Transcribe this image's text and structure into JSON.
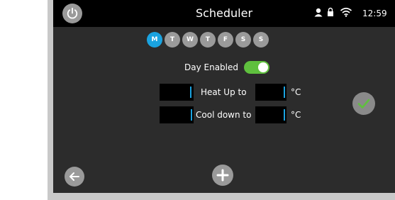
{
  "header": {
    "title": "Scheduler",
    "time": "12:59",
    "icons": [
      "power-icon",
      "user-icon",
      "lock-icon",
      "wifi-icon"
    ]
  },
  "days": {
    "items": [
      {
        "label": "M",
        "selected": true
      },
      {
        "label": "T",
        "selected": false
      },
      {
        "label": "W",
        "selected": false
      },
      {
        "label": "T",
        "selected": false
      },
      {
        "label": "F",
        "selected": false
      },
      {
        "label": "S",
        "selected": false
      },
      {
        "label": "S",
        "selected": false
      }
    ]
  },
  "day_enabled": {
    "label": "Day Enabled",
    "on": true
  },
  "heat": {
    "label": "Heat Up to",
    "unit": "°C",
    "start_value": "",
    "target_value": ""
  },
  "cool": {
    "label": "Cool down to",
    "unit": "°C",
    "start_value": "",
    "target_value": ""
  },
  "actions": {
    "confirm_icon": "check-icon",
    "back_icon": "arrow-left-icon",
    "add_icon": "plus-icon"
  },
  "colors": {
    "accent": "#1aa3e0",
    "toggle_on": "#5fc03e",
    "screen_bg": "#2c2c2c",
    "topbar_bg": "#000000",
    "button_grey": "#9a9a9a"
  }
}
